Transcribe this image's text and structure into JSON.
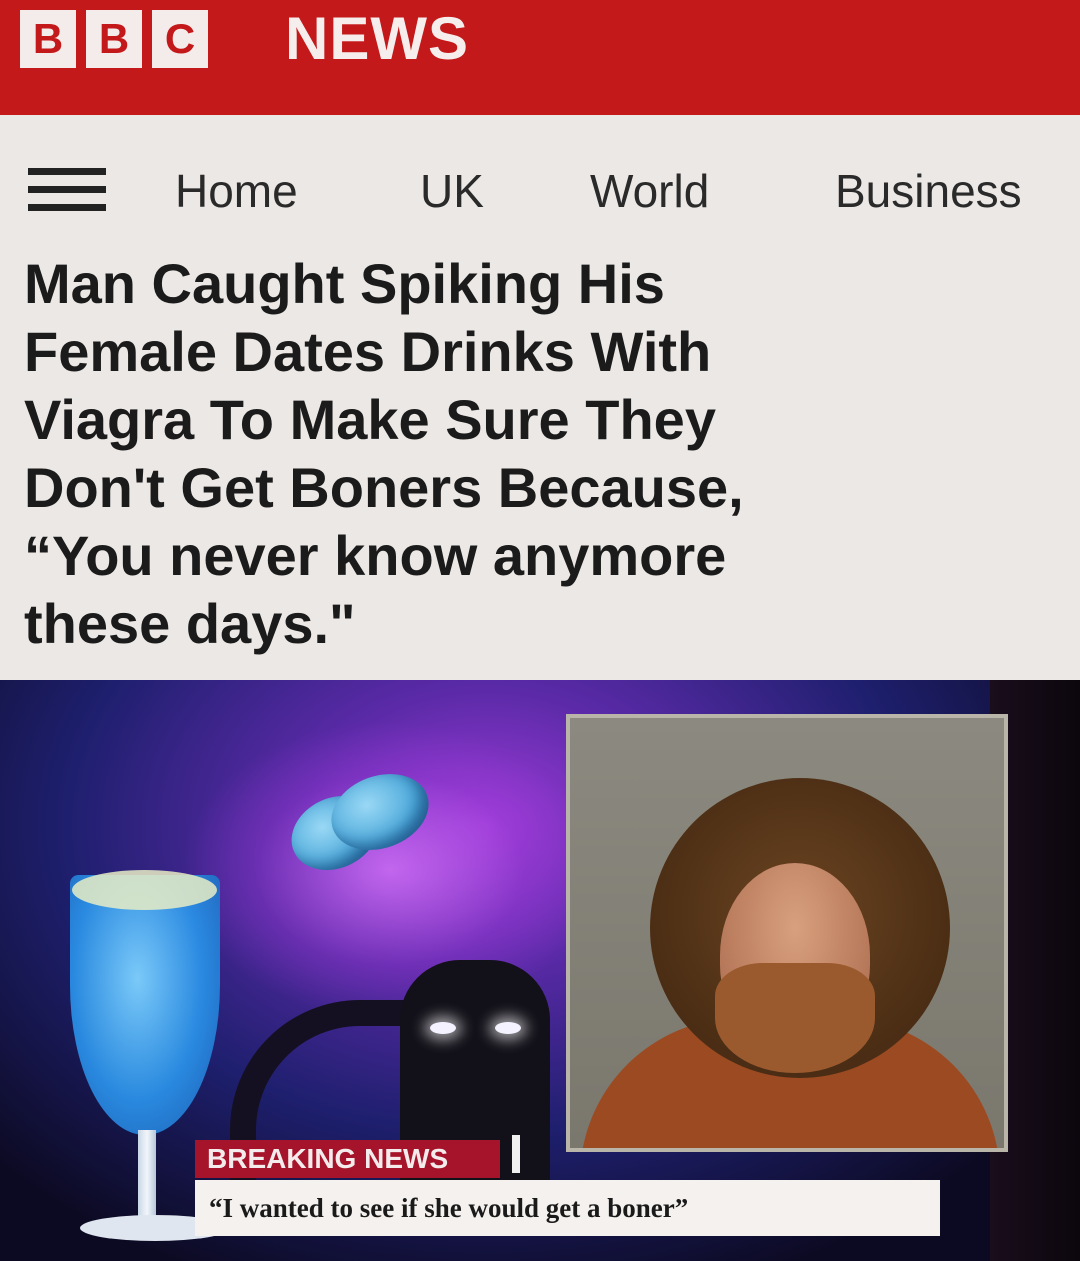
{
  "header": {
    "logo_letters": [
      "B",
      "B",
      "C"
    ],
    "section": "NEWS",
    "brand_color": "#c3191a"
  },
  "nav": {
    "menu_icon": "hamburger-icon",
    "items": [
      "Home",
      "UK",
      "World",
      "Business"
    ]
  },
  "article": {
    "headline": "Man Caught Spiking His\nFemale Dates Drinks With\nViagra To Make Sure They\nDon't Get Boners Because,\n“You never know anymore\nthese days.\""
  },
  "media": {
    "ticker_label": "BREAKING NEWS",
    "ticker_quote": "“I wanted to see if she would get a boner”",
    "ticker_color": "#a5142a"
  }
}
